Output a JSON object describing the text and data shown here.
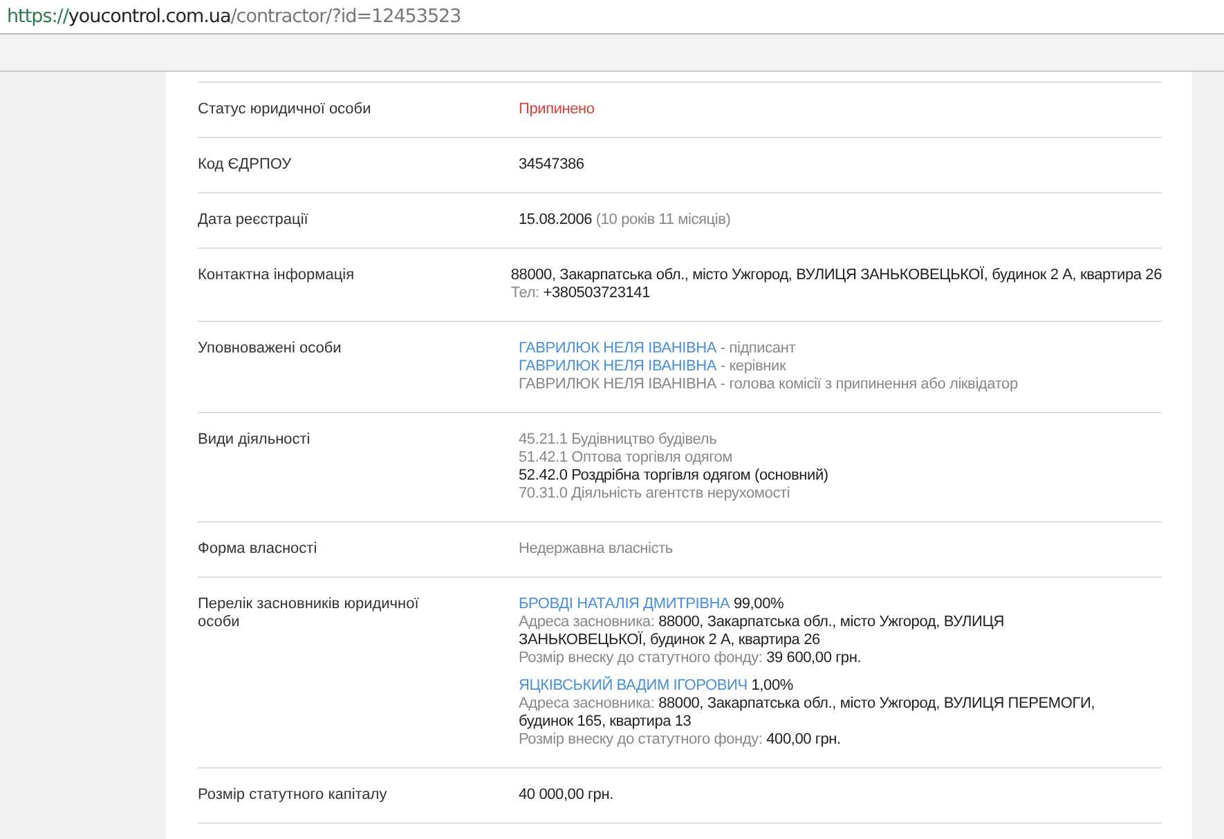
{
  "address_bar": {
    "url": [
      {
        "text": "https://",
        "kind": "scheme"
      },
      {
        "text": "youcontrol.com.ua",
        "kind": "host"
      },
      {
        "text": "/contractor/?id=12453523",
        "kind": "path"
      }
    ]
  },
  "rows": [
    {
      "label": "Статус юридичної особи",
      "kind": "lines",
      "lines": [
        [
          {
            "text": "Припинено",
            "kind": "red"
          }
        ]
      ]
    },
    {
      "label": "Код ЄДРПОУ",
      "kind": "lines",
      "lines": [
        [
          {
            "text": "34547386",
            "kind": "dark"
          }
        ]
      ]
    },
    {
      "label": "Дата реєстрації",
      "kind": "lines",
      "lines": [
        [
          {
            "text": "15.08.2006 ",
            "kind": "dark"
          },
          {
            "text": "(10 років 11 місяців)",
            "kind": "muted"
          }
        ]
      ]
    },
    {
      "label": "Контактна інформація",
      "kind": "lines",
      "lines": [
        [
          {
            "text": "88000, Закарпатська обл., місто Ужгород, ВУЛИЦЯ ЗАНЬКОВЕЦЬКОЇ, будинок 2 А, квартира 26",
            "kind": "dark"
          }
        ],
        [
          {
            "text": "Тел: ",
            "kind": "muted"
          },
          {
            "text": "+380503723141",
            "kind": "dark"
          }
        ]
      ]
    },
    {
      "label": "Уповноважені особи",
      "kind": "lines",
      "lines": [
        [
          {
            "text": "ГАВРИЛЮК НЕЛЯ ІВАНІВНА",
            "kind": "link"
          },
          {
            "text": " - підписант",
            "kind": "muted"
          }
        ],
        [
          {
            "text": "ГАВРИЛЮК НЕЛЯ ІВАНІВНА",
            "kind": "link"
          },
          {
            "text": " - керівник",
            "kind": "muted"
          }
        ],
        [
          {
            "text": "ГАВРИЛЮК НЕЛЯ ІВАНІВНА - голова комісії з припинення або ліквідатор",
            "kind": "muted"
          }
        ]
      ]
    },
    {
      "label": "Види діяльності",
      "kind": "lines",
      "lines": [
        [
          {
            "text": "45.21.1 Будівництво будівель",
            "kind": "muted"
          }
        ],
        [
          {
            "text": "51.42.1 Оптова торгівля одягом",
            "kind": "muted"
          }
        ],
        [
          {
            "text": "52.42.0 Роздрібна торгівля одягом (основний)",
            "kind": "dark"
          }
        ],
        [
          {
            "text": "70.31.0 Діяльність агентств нерухомості",
            "kind": "muted"
          }
        ]
      ]
    },
    {
      "label": "Форма власності",
      "kind": "lines",
      "lines": [
        [
          {
            "text": "Недержавна власність",
            "kind": "muted"
          }
        ]
      ]
    },
    {
      "label": "Перелік засновників юридичної особи",
      "kind": "founders",
      "founders": [
        {
          "name": "БРОВДІ НАТАЛІЯ ДМИТРІВНА",
          "share": "99,00%",
          "address_label": "Адреса засновника:",
          "address": "88000, Закарпатська обл., місто Ужгород, ВУЛИЦЯ ЗАНЬКОВЕЦЬКОЇ, будинок 2 А, квартира 26",
          "contribution_label": "Розмір внеску до статутного фонду:",
          "contribution": "39 600,00 грн."
        },
        {
          "name": "ЯЦКІВСЬКИЙ ВАДИМ ІГОРОВИЧ",
          "share": "1,00%",
          "address_label": "Адреса засновника:",
          "address": "88000, Закарпатська обл., місто Ужгород, ВУЛИЦЯ ПЕРЕМОГИ, будинок 165, квартира 13",
          "contribution_label": "Розмір внеску до статутного фонду:",
          "contribution": "400,00 грн."
        }
      ]
    },
    {
      "label": "Розмір статутного капіталу",
      "kind": "lines",
      "lines": [
        [
          {
            "text": "40 000,00 грн.",
            "kind": "dark"
          }
        ]
      ]
    }
  ]
}
